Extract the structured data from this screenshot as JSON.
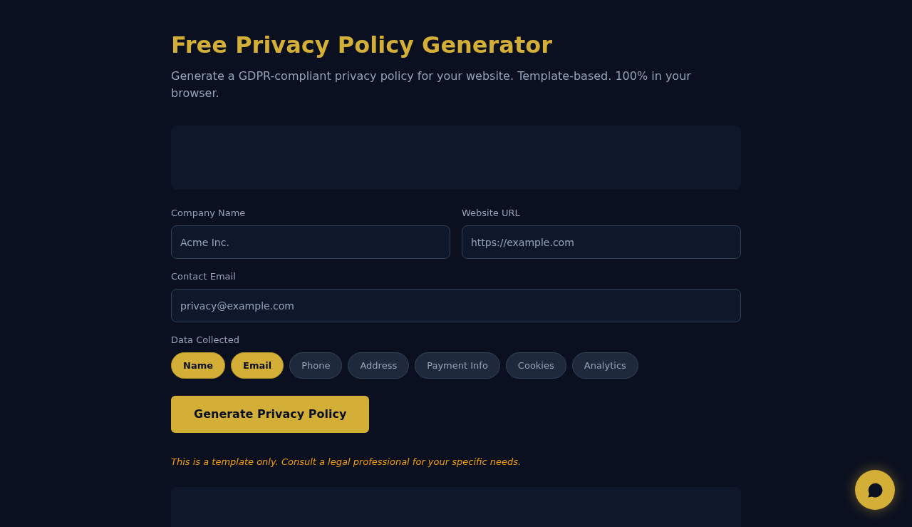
{
  "header": {
    "title": "Free Privacy Policy Generator",
    "subtitle": "Generate a GDPR-compliant privacy policy for your website. Template-based. 100% in your browser."
  },
  "field_rows": [
    [
      {
        "label": "Company Name",
        "placeholder": "Acme Inc."
      },
      {
        "label": "Website URL",
        "placeholder": "https://example.com"
      }
    ],
    [
      {
        "label": "Contact Email",
        "placeholder": "privacy@example.com"
      }
    ]
  ],
  "data_collected": {
    "label": "Data Collected",
    "options": [
      {
        "label": "Name",
        "selected": true
      },
      {
        "label": "Email",
        "selected": true
      },
      {
        "label": "Phone",
        "selected": false
      },
      {
        "label": "Address",
        "selected": false
      },
      {
        "label": "Payment Info",
        "selected": false
      },
      {
        "label": "Cookies",
        "selected": false
      },
      {
        "label": "Analytics",
        "selected": false
      }
    ]
  },
  "generate_button": "Generate Privacy Policy",
  "disclaimer": "This is a template only. Consult a legal professional for your specific needs."
}
